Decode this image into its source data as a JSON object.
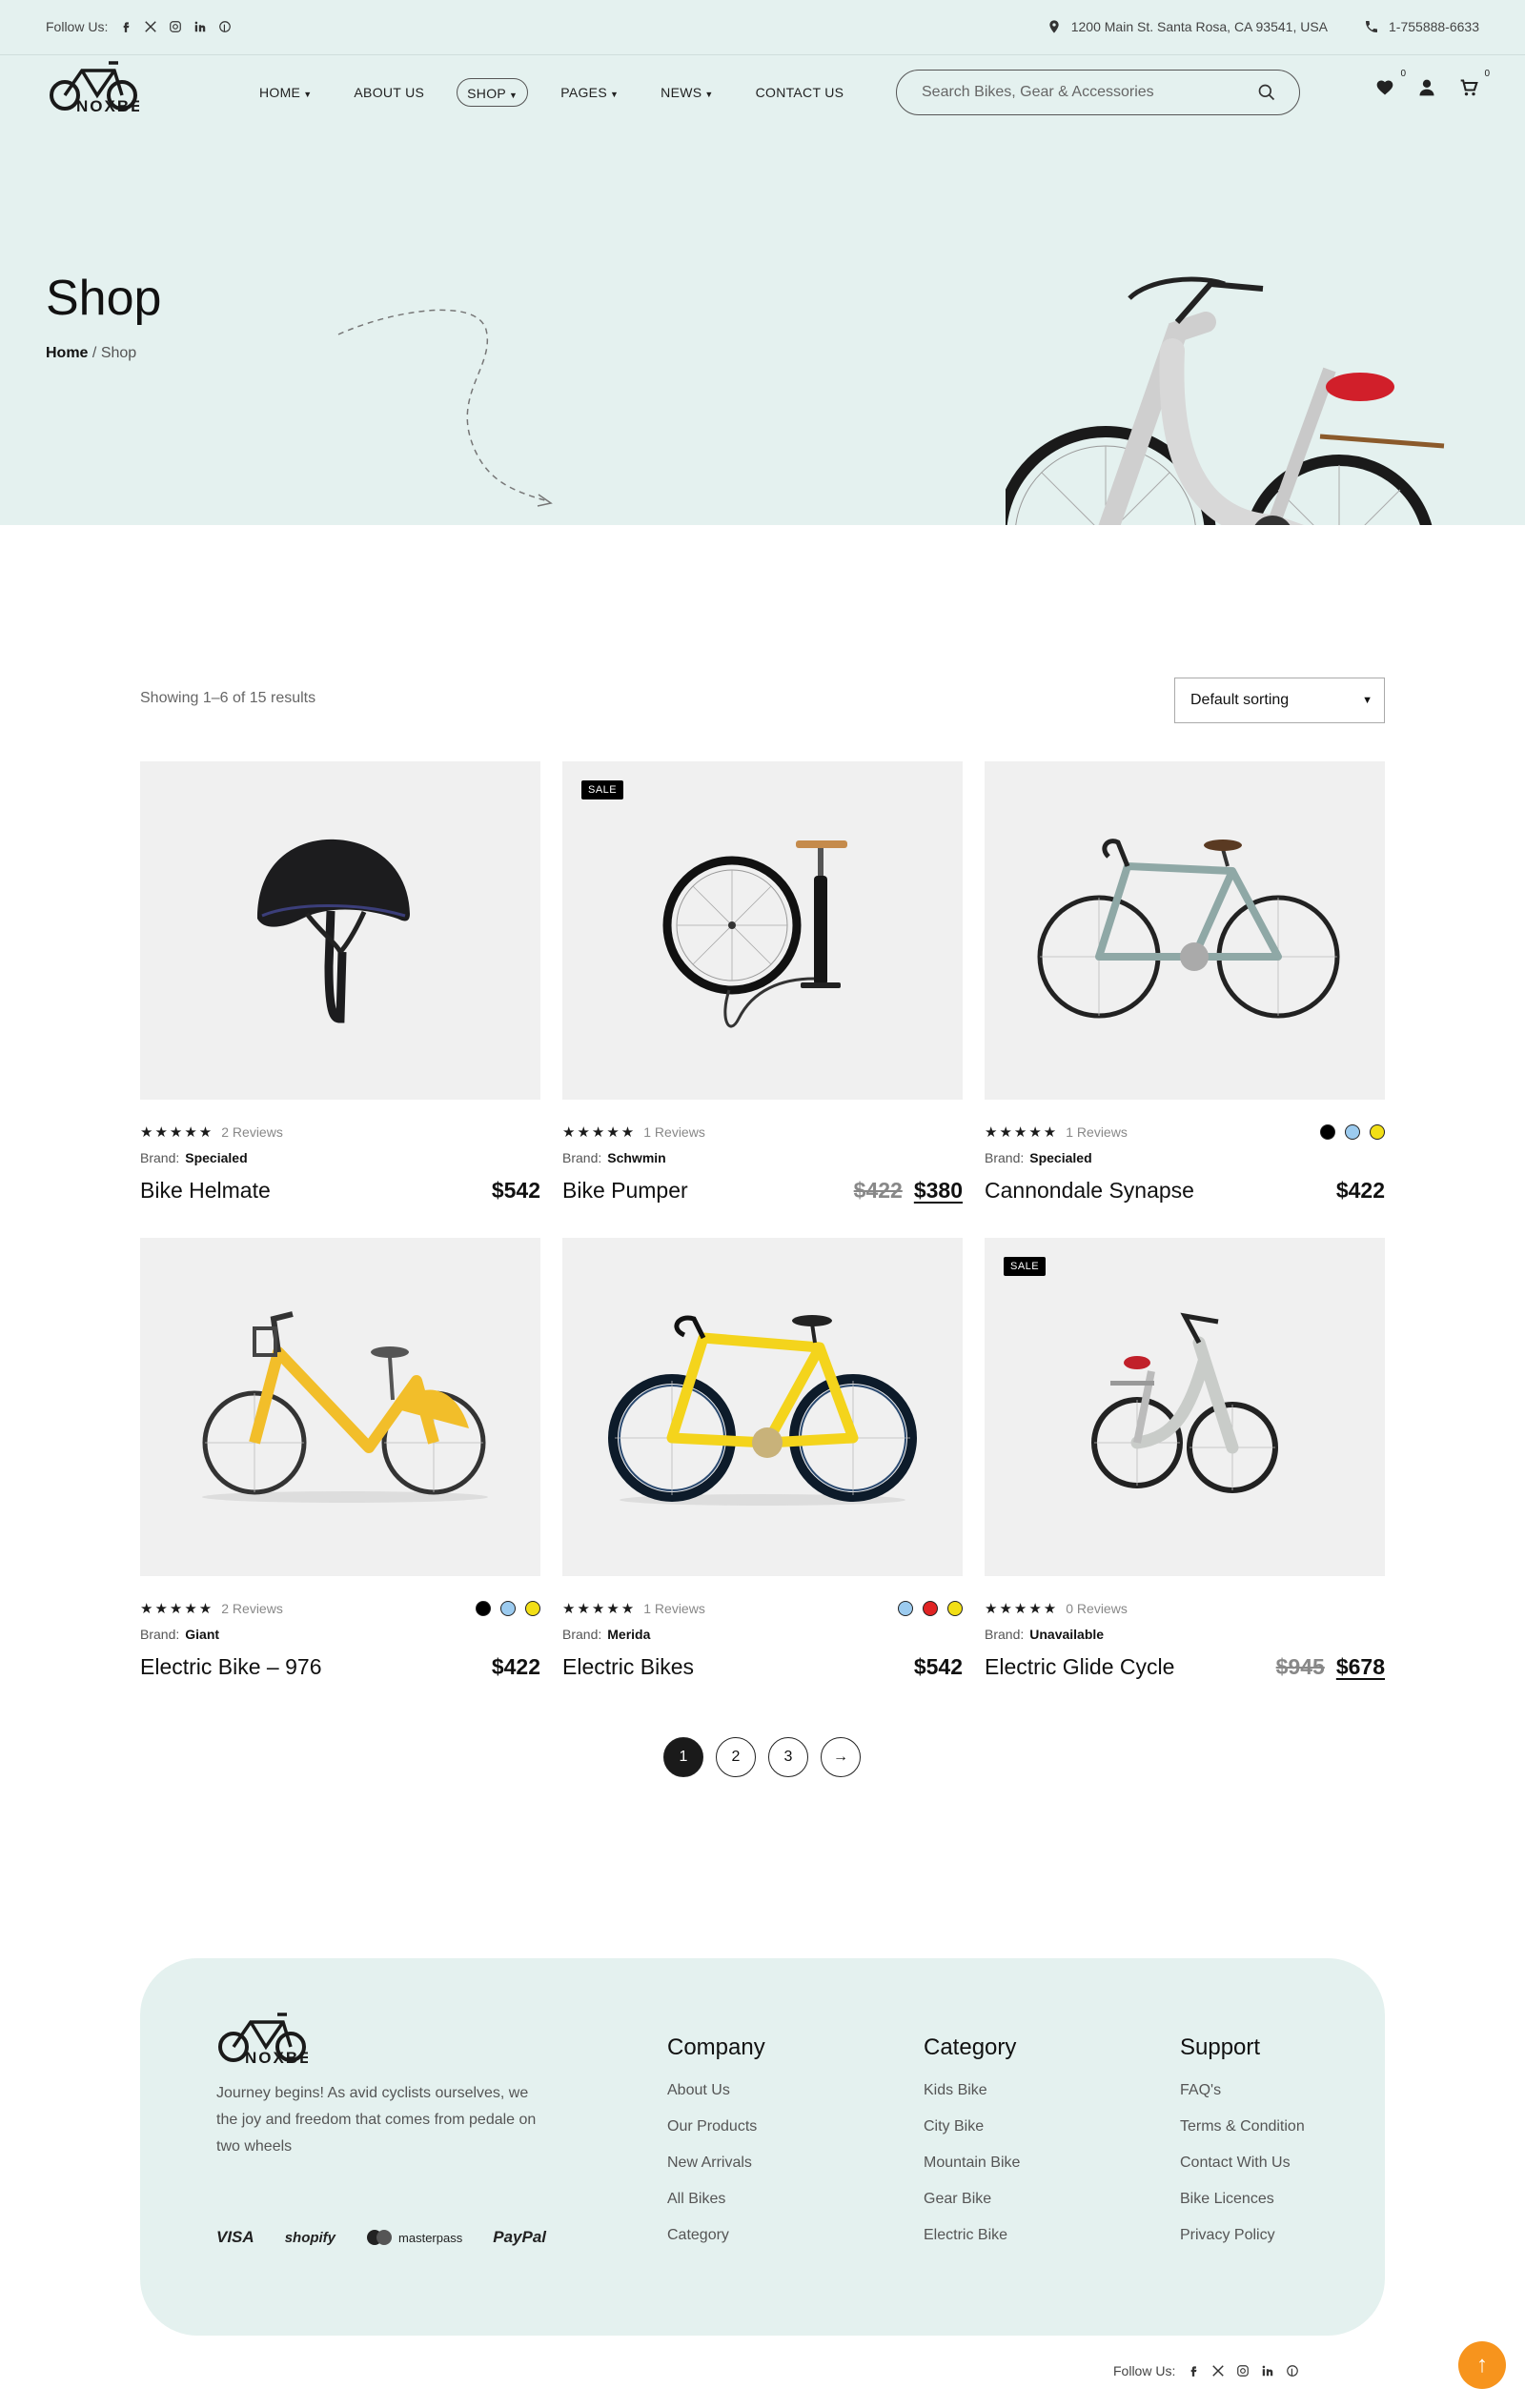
{
  "topbar": {
    "follow_label": "Follow Us:",
    "address": "1200 Main St. Santa Rosa, CA 93541, USA",
    "phone": "1-755888-6633"
  },
  "nav": {
    "items": [
      {
        "label": "HOME"
      },
      {
        "label": "ABOUT US"
      },
      {
        "label": "SHOP"
      },
      {
        "label": "PAGES"
      },
      {
        "label": "NEWS"
      },
      {
        "label": "CONTACT US"
      }
    ]
  },
  "search": {
    "placeholder": "Search Bikes, Gear & Accessories"
  },
  "header_icons": {
    "wishlist_count": "0",
    "cart_count": "0"
  },
  "logo_text": "NOXBE",
  "hero": {
    "title": "Shop",
    "crumb_home": "Home",
    "crumb_sep": "/",
    "crumb_current": "Shop"
  },
  "toolbar": {
    "results": "Showing 1–6 of 15 results",
    "sort": "Default sorting"
  },
  "products": [
    {
      "name": "Bike Helmate",
      "reviews": "2 Reviews",
      "brand_label": "Brand:",
      "brand": "Specialed",
      "price": "$542",
      "old_price": "",
      "sale": ""
    },
    {
      "name": "Bike Pumper",
      "reviews": "1 Reviews",
      "brand_label": "Brand:",
      "brand": "Schwmin",
      "price": "$380",
      "old_price": "$422",
      "sale": "SALE"
    },
    {
      "name": "Cannondale Synapse",
      "reviews": "1 Reviews",
      "brand_label": "Brand:",
      "brand": "Specialed",
      "price": "$422",
      "old_price": "",
      "sale": "",
      "swatches": [
        "#000000",
        "#9ccbef",
        "#f2df16"
      ]
    },
    {
      "name": "Electric Bike – 976",
      "reviews": "2 Reviews",
      "brand_label": "Brand:",
      "brand": "Giant",
      "price": "$422",
      "old_price": "",
      "sale": "",
      "swatches": [
        "#000000",
        "#9ccbef",
        "#f2df16"
      ]
    },
    {
      "name": "Electric Bikes",
      "reviews": "1 Reviews",
      "brand_label": "Brand:",
      "brand": "Merida",
      "price": "$542",
      "old_price": "",
      "sale": "",
      "swatches": [
        "#9ccbef",
        "#e02424",
        "#f2df16"
      ]
    },
    {
      "name": "Electric Glide Cycle",
      "reviews": "0 Reviews",
      "brand_label": "Brand:",
      "brand": "Unavailable",
      "price": "$678",
      "old_price": "$945",
      "sale": "SALE"
    }
  ],
  "stars": "★★★★★",
  "pagination": {
    "pages": [
      "1",
      "2",
      "3"
    ],
    "next": "→"
  },
  "footer": {
    "description": "Journey begins! As avid cyclists ourselves, we the joy and freedom that comes from pedale on two wheels",
    "payments": [
      "VISA",
      "shopify",
      "masterpass",
      "PayPal"
    ],
    "columns": [
      {
        "title": "Company",
        "links": [
          "About Us",
          "Our Products",
          "New Arrivals",
          "All Bikes",
          "Category"
        ]
      },
      {
        "title": "Category",
        "links": [
          "Kids Bike",
          "City Bike",
          "Mountain Bike",
          "Gear Bike",
          "Electric Bike"
        ]
      },
      {
        "title": "Support",
        "links": [
          "FAQ's",
          "Terms & Condition",
          "Contact With Us",
          "Bike Licences",
          "Privacy Policy"
        ]
      }
    ],
    "follow_label": "Follow Us:"
  },
  "scroll_top": "↑",
  "colors": {
    "mint": "#e4f1ef",
    "accent": "#f7941d"
  }
}
